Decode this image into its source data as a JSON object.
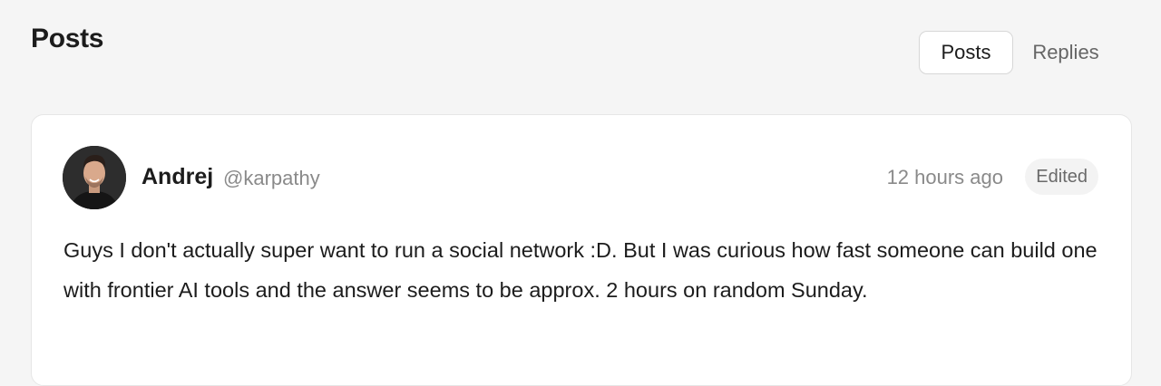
{
  "header": {
    "title": "Posts"
  },
  "tabs": [
    {
      "label": "Posts",
      "active": true
    },
    {
      "label": "Replies",
      "active": false
    }
  ],
  "post": {
    "author_name": "Andrej",
    "author_handle": "@karpathy",
    "timestamp": "12 hours ago",
    "edited_label": "Edited",
    "body": "Guys I don't actually super want to run a social network :D. But I was curious how fast someone can build one with frontier AI tools and the answer seems to be approx. 2 hours on random Sunday."
  },
  "colors": {
    "background": "#f5f5f5",
    "card": "#ffffff",
    "muted_text": "#8a8a8a",
    "badge_bg": "#f3f3f3"
  }
}
